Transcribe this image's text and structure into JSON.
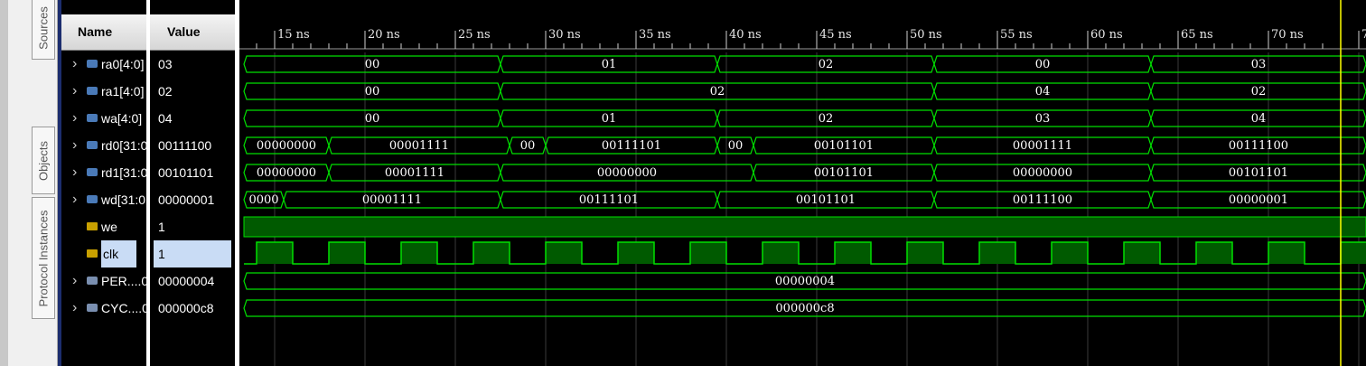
{
  "tabs": {
    "sources": "Sources",
    "objects": "Objects",
    "protocol": "Protocol Instances"
  },
  "headers": {
    "name": "Name",
    "value": "Value"
  },
  "signals": [
    {
      "name": "ra0[4:0]",
      "value": "03",
      "icon": "bus-icon",
      "expandable": true
    },
    {
      "name": "ra1[4:0]",
      "value": "02",
      "icon": "bus-icon",
      "expandable": true
    },
    {
      "name": "wa[4:0]",
      "value": "04",
      "icon": "bus-icon",
      "expandable": true
    },
    {
      "name": "rd0[31:0",
      "value": "00111100",
      "icon": "bus-icon",
      "expandable": true
    },
    {
      "name": "rd1[31:0",
      "value": "00101101",
      "icon": "bus-icon",
      "expandable": true
    },
    {
      "name": "wd[31:0",
      "value": "00000001",
      "icon": "bus-icon",
      "expandable": true
    },
    {
      "name": "we",
      "value": "1",
      "icon": "wire-icon",
      "expandable": false
    },
    {
      "name": "clk",
      "value": "1",
      "icon": "wire-icon",
      "expandable": false,
      "selected": true
    },
    {
      "name": "PER....0",
      "value": "00000004",
      "icon": "param-icon",
      "expandable": true
    },
    {
      "name": "CYC....0",
      "value": "000000c8",
      "icon": "param-icon",
      "expandable": true
    }
  ],
  "timeline": {
    "unit": "ns",
    "ticks": [
      {
        "t": 15,
        "label": "15 ns"
      },
      {
        "t": 20,
        "label": "20 ns"
      },
      {
        "t": 25,
        "label": "25 ns"
      },
      {
        "t": 30,
        "label": "30 ns"
      },
      {
        "t": 35,
        "label": "35 ns"
      },
      {
        "t": 40,
        "label": "40 ns"
      },
      {
        "t": 45,
        "label": "45 ns"
      },
      {
        "t": 50,
        "label": "50 ns"
      },
      {
        "t": 55,
        "label": "55 ns"
      },
      {
        "t": 60,
        "label": "60 ns"
      },
      {
        "t": 65,
        "label": "65 ns"
      },
      {
        "t": 70,
        "label": "70 ns"
      },
      {
        "t": 75,
        "label": "7"
      }
    ],
    "cursor_ns": 74,
    "view_start_ns": 13.3,
    "view_end_ns": 75.4
  },
  "waves": [
    {
      "type": "bus",
      "segments": [
        {
          "t0": 13.3,
          "t1": 27.5,
          "v": "00"
        },
        {
          "t0": 27.5,
          "t1": 39.5,
          "v": "01"
        },
        {
          "t0": 39.5,
          "t1": 51.5,
          "v": "02"
        },
        {
          "t0": 51.5,
          "t1": 63.5,
          "v": "00"
        },
        {
          "t0": 63.5,
          "t1": 75.4,
          "v": "03"
        }
      ]
    },
    {
      "type": "bus",
      "segments": [
        {
          "t0": 13.3,
          "t1": 27.5,
          "v": "00"
        },
        {
          "t0": 27.5,
          "t1": 51.5,
          "v": "02"
        },
        {
          "t0": 51.5,
          "t1": 63.5,
          "v": "04"
        },
        {
          "t0": 63.5,
          "t1": 75.4,
          "v": "02"
        }
      ]
    },
    {
      "type": "bus",
      "segments": [
        {
          "t0": 13.3,
          "t1": 27.5,
          "v": "00"
        },
        {
          "t0": 27.5,
          "t1": 39.5,
          "v": "01"
        },
        {
          "t0": 39.5,
          "t1": 51.5,
          "v": "02"
        },
        {
          "t0": 51.5,
          "t1": 63.5,
          "v": "03"
        },
        {
          "t0": 63.5,
          "t1": 75.4,
          "v": "04"
        }
      ]
    },
    {
      "type": "bus",
      "segments": [
        {
          "t0": 13.3,
          "t1": 18.0,
          "v": "00000000"
        },
        {
          "t0": 18.0,
          "t1": 28.0,
          "v": "00001111"
        },
        {
          "t0": 28.0,
          "t1": 30.0,
          "v": "00"
        },
        {
          "t0": 30.0,
          "t1": 39.5,
          "v": "00111101"
        },
        {
          "t0": 39.5,
          "t1": 41.5,
          "v": "00"
        },
        {
          "t0": 41.5,
          "t1": 51.5,
          "v": "00101101"
        },
        {
          "t0": 51.5,
          "t1": 63.5,
          "v": "00001111"
        },
        {
          "t0": 63.5,
          "t1": 75.4,
          "v": "00111100"
        }
      ]
    },
    {
      "type": "bus",
      "segments": [
        {
          "t0": 13.3,
          "t1": 18.0,
          "v": "00000000"
        },
        {
          "t0": 18.0,
          "t1": 27.5,
          "v": "00001111"
        },
        {
          "t0": 27.5,
          "t1": 41.5,
          "v": "00000000"
        },
        {
          "t0": 41.5,
          "t1": 51.5,
          "v": "00101101"
        },
        {
          "t0": 51.5,
          "t1": 63.5,
          "v": "00000000"
        },
        {
          "t0": 63.5,
          "t1": 75.4,
          "v": "00101101"
        }
      ]
    },
    {
      "type": "bus",
      "segments": [
        {
          "t0": 13.3,
          "t1": 15.5,
          "v": "0000"
        },
        {
          "t0": 15.5,
          "t1": 27.5,
          "v": "00001111"
        },
        {
          "t0": 27.5,
          "t1": 39.5,
          "v": "00111101"
        },
        {
          "t0": 39.5,
          "t1": 51.5,
          "v": "00101101"
        },
        {
          "t0": 51.5,
          "t1": 63.5,
          "v": "00111100"
        },
        {
          "t0": 63.5,
          "t1": 75.4,
          "v": "00000001"
        }
      ]
    },
    {
      "type": "high"
    },
    {
      "type": "clock",
      "first_rise": 14,
      "period": 4
    },
    {
      "type": "bus",
      "segments": [
        {
          "t0": 13.3,
          "t1": 75.4,
          "v": "00000004"
        }
      ]
    },
    {
      "type": "bus",
      "segments": [
        {
          "t0": 13.3,
          "t1": 75.4,
          "v": "000000c8"
        }
      ]
    }
  ],
  "colors": {
    "wave": "#00e000",
    "fill": "#005a00",
    "grid": "#3a3a3a",
    "cursor": "#ffff00",
    "text": "#ffffff"
  }
}
